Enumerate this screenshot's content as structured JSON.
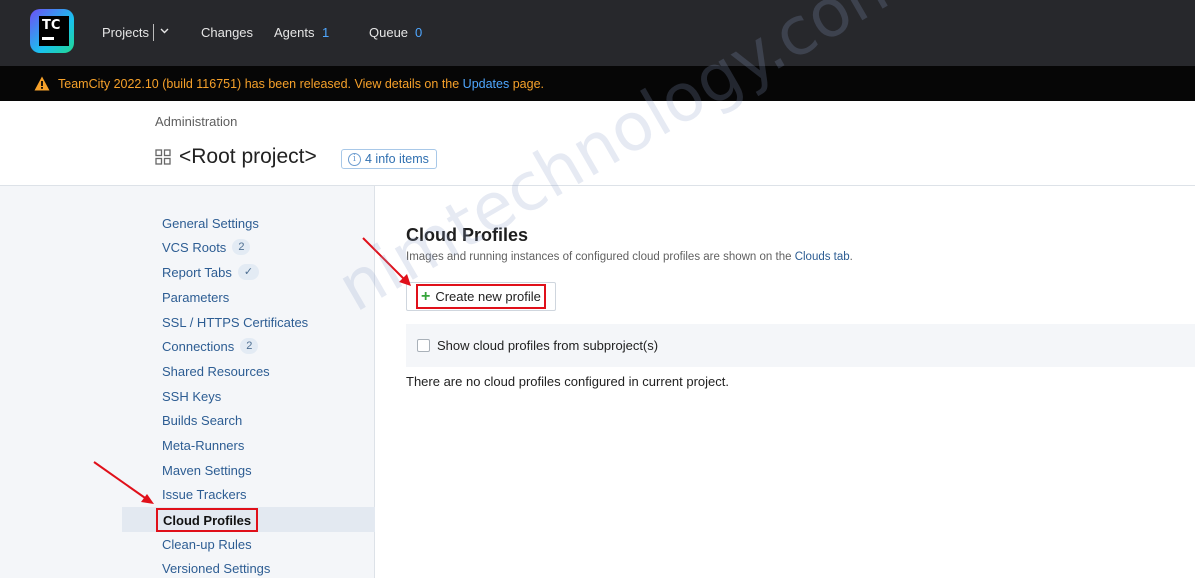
{
  "topnav": {
    "logo_text": "TC",
    "projects_label": "Projects",
    "changes_label": "Changes",
    "agents_label": "Agents",
    "agents_count": "1",
    "queue_label": "Queue",
    "queue_count": "0"
  },
  "banner": {
    "text_before": "TeamCity 2022.10 (build 116751) has been released. View details on the ",
    "link": "Updates",
    "text_after": " page."
  },
  "header": {
    "breadcrumb": "Administration",
    "title": "<Root project>",
    "info_badge": "4 info items"
  },
  "sidebar": {
    "items": [
      {
        "label": "General Settings"
      },
      {
        "label": "VCS Roots",
        "badge": "2"
      },
      {
        "label": "Report Tabs",
        "badge": "✓"
      },
      {
        "label": "Parameters"
      },
      {
        "label": "SSL / HTTPS Certificates"
      },
      {
        "label": "Connections",
        "badge": "2"
      },
      {
        "label": "Shared Resources"
      },
      {
        "label": "SSH Keys"
      },
      {
        "label": "Builds Search"
      },
      {
        "label": "Meta-Runners"
      },
      {
        "label": "Maven Settings"
      },
      {
        "label": "Issue Trackers"
      },
      {
        "label": "Cloud Profiles"
      },
      {
        "label": "Clean-up Rules"
      },
      {
        "label": "Versioned Settings"
      }
    ]
  },
  "main": {
    "title": "Cloud Profiles",
    "desc_before": "Images and running instances of configured cloud profiles are shown on the ",
    "desc_link": "Clouds tab",
    "desc_after": ".",
    "create_button": "Create new profile",
    "subprojects_label": "Show cloud profiles from subproject(s)",
    "empty_message": "There are no cloud profiles configured in current project."
  },
  "watermark": "nimtechnology.com",
  "colors": {
    "nav_bg": "#27282c",
    "banner_text": "#f6a12a",
    "link": "#2d5d93",
    "annotation_red": "#e0101a"
  }
}
